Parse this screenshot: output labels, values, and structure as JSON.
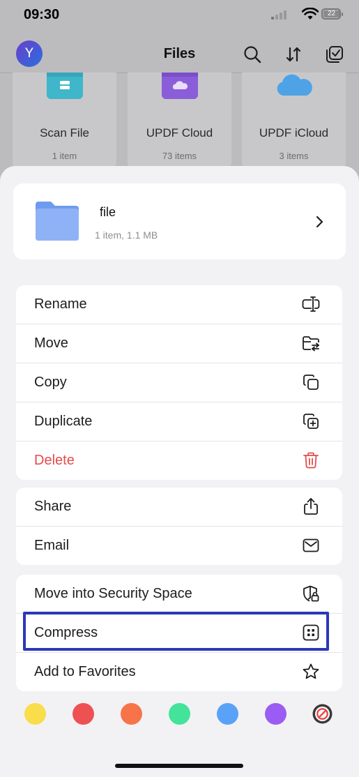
{
  "status_bar": {
    "time": "09:30",
    "battery": "22"
  },
  "header": {
    "avatar_initial": "Y",
    "title": "Files"
  },
  "tiles": [
    {
      "name": "Scan File",
      "count": "1 item",
      "icon": "scan-folder-icon"
    },
    {
      "name": "UPDF Cloud",
      "count": "73 items",
      "icon": "cloud-folder-icon"
    },
    {
      "name": "UPDF iCloud",
      "count": "3 items",
      "icon": "icloud-icon"
    }
  ],
  "file": {
    "name": "file",
    "meta": "1 item, 1.1 MB"
  },
  "menu": {
    "group1": [
      {
        "label": "Rename",
        "icon": "rename-icon"
      },
      {
        "label": "Move",
        "icon": "move-folder-icon"
      },
      {
        "label": "Copy",
        "icon": "copy-icon"
      },
      {
        "label": "Duplicate",
        "icon": "duplicate-icon"
      },
      {
        "label": "Delete",
        "icon": "trash-icon"
      }
    ],
    "group2": [
      {
        "label": "Share",
        "icon": "share-icon"
      },
      {
        "label": "Email",
        "icon": "mail-icon"
      }
    ],
    "group3": [
      {
        "label": "Move into Security Space",
        "icon": "shield-lock-icon"
      },
      {
        "label": "Compress",
        "icon": "compress-icon"
      },
      {
        "label": "Add to Favorites",
        "icon": "star-icon"
      }
    ]
  },
  "color_tags": [
    "#f9dd4a",
    "#ee5151",
    "#f7744a",
    "#43e39a",
    "#5aa2f7",
    "#9b5cf3"
  ],
  "colors": {
    "accent_highlight": "#2b38b8",
    "destructive": "#e54b4b"
  }
}
